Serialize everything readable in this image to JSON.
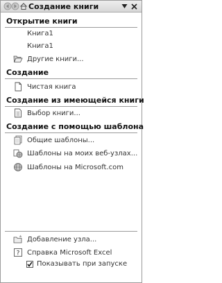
{
  "header": {
    "title": "Создание книги",
    "icons": [
      "back-arrow-icon",
      "forward-arrow-icon",
      "home-icon",
      "chevron-down-icon",
      "close-icon"
    ]
  },
  "sections": {
    "open": {
      "title": "Открытие книги",
      "recent": [
        "Книга1",
        "Книга1"
      ],
      "more": "Другие книги..."
    },
    "create": {
      "title": "Создание",
      "blank": "Чистая книга"
    },
    "from_existing": {
      "title": "Создание из имеющейся книги",
      "choose": "Выбор книги..."
    },
    "from_template": {
      "title": "Создание с помощью шаблона",
      "general": "Общие шаблоны...",
      "my_sites": "Шаблоны на моих веб-узлах...",
      "microsoft": "Шаблоны на Microsoft.com"
    }
  },
  "footer": {
    "add_location": "Добавление узла...",
    "help": "Справка Microsoft Excel",
    "show_on_startup": "Показывать при запуске",
    "show_on_startup_checked": true
  }
}
